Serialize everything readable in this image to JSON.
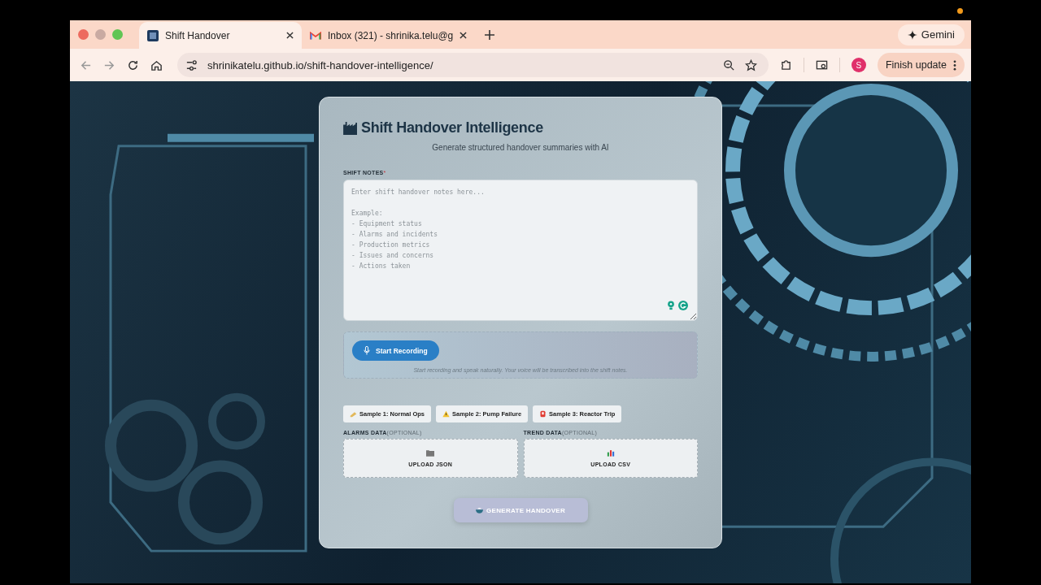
{
  "browser": {
    "tabs": [
      {
        "title": "Shift Handover",
        "selected": true,
        "kind": "app"
      },
      {
        "title": "Inbox (321) - shrinika.telu@g",
        "selected": false,
        "kind": "mail"
      }
    ],
    "gemini": "Gemini",
    "url": "shrinikatelu.github.io/shift-handover-intelligence/",
    "profile": "S",
    "update": "Finish update"
  },
  "app": {
    "title": "Shift Handover Intelligence",
    "subtitle": "Generate structured handover summaries with AI",
    "notes_label": "SHIFT NOTES",
    "required_mark": "*",
    "notes_placeholder": "Enter shift handover notes here...\n\nExample:\n- Equipment status\n- Alarms and incidents\n- Production metrics\n- Issues and concerns\n- Actions taken",
    "record_button": "Start Recording",
    "record_hint": "Start recording and speak naturally. Your voice will be transcribed into the shift notes.",
    "samples": [
      {
        "label": "Sample 1: Normal Ops",
        "kind": "note"
      },
      {
        "label": "Sample 2: Pump Failure",
        "kind": "warning"
      },
      {
        "label": "Sample 3: Reactor Trip",
        "kind": "alarm"
      }
    ],
    "uploads": [
      {
        "label": "ALARMS DATA",
        "optional": "(OPTIONAL)",
        "button": "UPLOAD JSON",
        "kind": "folder"
      },
      {
        "label": "TREND DATA",
        "optional": "(OPTIONAL)",
        "button": "UPLOAD CSV",
        "kind": "chart"
      }
    ],
    "generate": {
      "label": "GENERATE HANDOVER",
      "disabled": true
    }
  }
}
